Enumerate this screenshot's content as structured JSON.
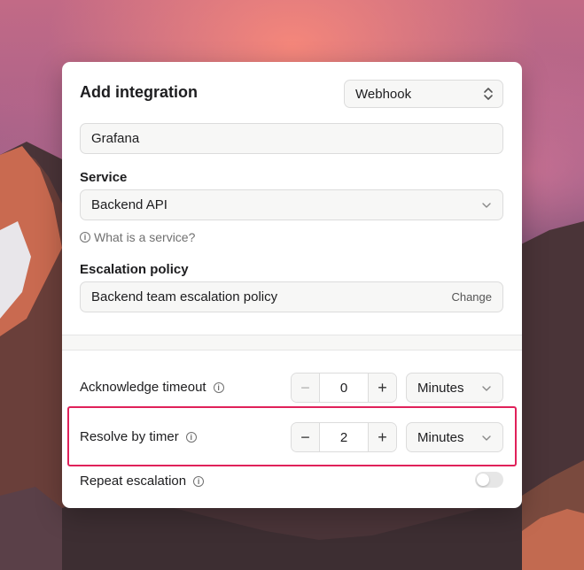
{
  "dialog": {
    "title": "Add integration",
    "type_select": "Webhook",
    "name_value": "Grafana",
    "service_label": "Service",
    "service_value": "Backend API",
    "service_help": "What is a service?",
    "escalation_label": "Escalation policy",
    "escalation_value": "Backend team escalation policy",
    "escalation_change": "Change"
  },
  "settings": {
    "ack_timeout": {
      "label": "Acknowledge timeout",
      "value": "0",
      "unit": "Minutes"
    },
    "resolve_timer": {
      "label": "Resolve by timer",
      "value": "2",
      "unit": "Minutes"
    },
    "repeat_escalation": {
      "label": "Repeat escalation",
      "enabled": false
    }
  },
  "icons": {
    "info": "i",
    "minus": "−",
    "plus": "+"
  },
  "colors": {
    "highlight": "#e0215a"
  }
}
